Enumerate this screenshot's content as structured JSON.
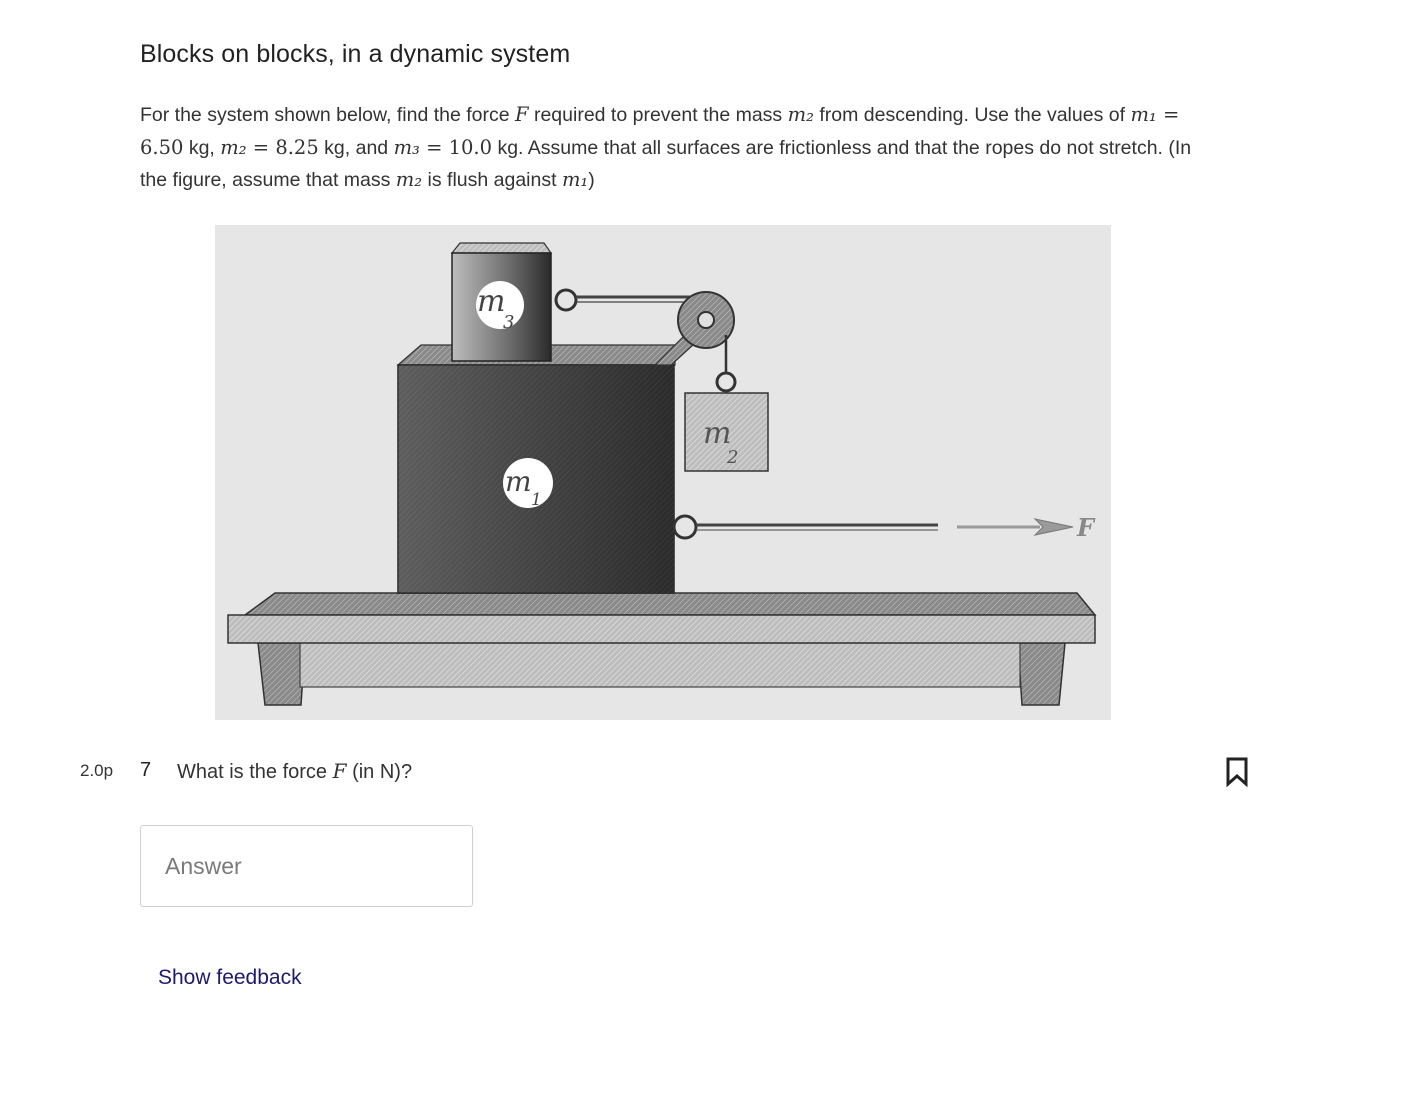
{
  "question": {
    "title": "Blocks on blocks, in a dynamic system",
    "desc_part1": "For the system shown below, find the force ",
    "F": "F",
    "desc_part2": " required to prevent the mass ",
    "m2_symbol": "m₂",
    "desc_part3": " from descending. Use the values of ",
    "m1_symbol": "m₁",
    "eq1": " = 6.50",
    "unit_kg_1": " kg, ",
    "eq2": " = 8.25",
    "unit_kg_2": " kg, and ",
    "m3_symbol": "m₃",
    "eq3": " = 10.0",
    "desc_part4": " kg. Assume that all surfaces are frictionless and that the ropes do not stretch. (In the figure, assume that mass ",
    "desc_part5": " is flush against ",
    "desc_part6": ")"
  },
  "figure": {
    "label_m3": "m",
    "label_m3_sub": "3",
    "label_m1": "m",
    "label_m1_sub": "1",
    "label_m2": "m",
    "label_m2_sub": "2",
    "label_force": "F"
  },
  "item": {
    "points": "2.0p",
    "number": "7",
    "text_before": "What is the force ",
    "F": "F",
    "text_after": " (in N)?"
  },
  "answer": {
    "placeholder": "Answer",
    "value": ""
  },
  "feedback_link": "Show feedback"
}
